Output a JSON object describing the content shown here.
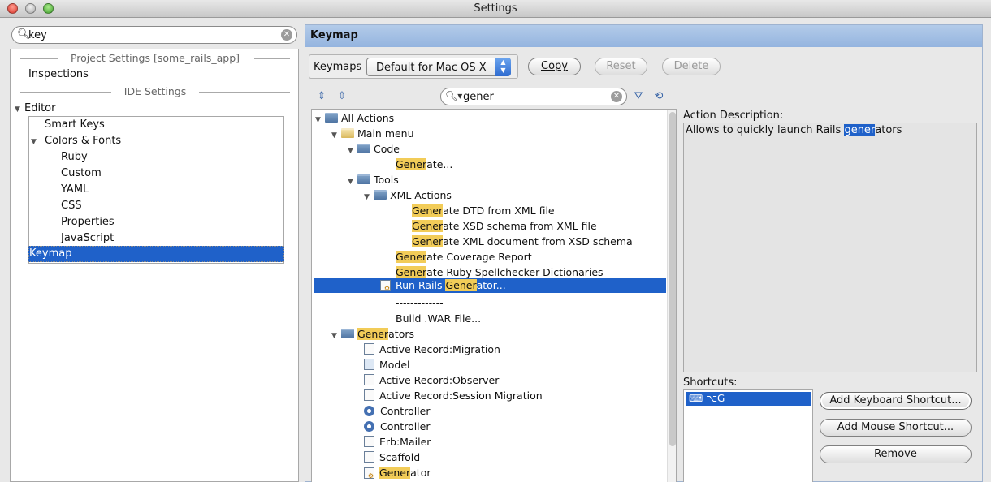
{
  "window": {
    "title": "Settings"
  },
  "left": {
    "search_value": "key",
    "sections": [
      "Project Settings [some_rails_app]",
      "IDE Settings"
    ],
    "inspections": "Inspections",
    "editor": "Editor",
    "smart_keys": "Smart Keys",
    "colors_fonts": "Colors & Fonts",
    "color_items": [
      "Ruby",
      "Custom",
      "YAML",
      "CSS",
      "Properties",
      "JavaScript"
    ],
    "keymap": "Keymap"
  },
  "header": {
    "title": "Keymap"
  },
  "keymaps": {
    "label": "Keymaps",
    "selected": "Default for Mac OS X"
  },
  "buttons": {
    "copy": "Copy",
    "reset": "Reset",
    "delete": "Delete"
  },
  "filter": {
    "value": "gener"
  },
  "tree": [
    {
      "pre": "",
      "hl": "",
      "post": "All Actions"
    },
    {
      "pre": "",
      "hl": "",
      "post": "Main menu"
    },
    {
      "pre": "",
      "hl": "",
      "post": "Code"
    },
    {
      "pre": "",
      "hl": "Gener",
      "post": "ate..."
    },
    {
      "pre": "",
      "hl": "",
      "post": "Tools"
    },
    {
      "pre": "",
      "hl": "",
      "post": "XML Actions"
    },
    {
      "pre": "",
      "hl": "Gener",
      "post": "ate DTD from XML file"
    },
    {
      "pre": "",
      "hl": "Gener",
      "post": "ate XSD schema from XML file"
    },
    {
      "pre": "",
      "hl": "Gener",
      "post": "ate XML document from XSD schema"
    },
    {
      "pre": "",
      "hl": "Gener",
      "post": "ate Coverage Report"
    },
    {
      "pre": "",
      "hl": "Gener",
      "post": "ate Ruby Spellchecker Dictionaries"
    },
    {
      "pre": "Run Rails ",
      "hl": "Gener",
      "post": "ator..."
    },
    {
      "pre": "",
      "hl": "",
      "post": "-------------"
    },
    {
      "pre": "",
      "hl": "",
      "post": "Build .WAR File..."
    },
    {
      "pre": "",
      "hl": "Gener",
      "post": "ators"
    },
    {
      "pre": "",
      "hl": "",
      "post": "Active Record:Migration"
    },
    {
      "pre": "",
      "hl": "",
      "post": "Model"
    },
    {
      "pre": "",
      "hl": "",
      "post": "Active Record:Observer"
    },
    {
      "pre": "",
      "hl": "",
      "post": "Active Record:Session Migration"
    },
    {
      "pre": "",
      "hl": "",
      "post": "Controller"
    },
    {
      "pre": "",
      "hl": "",
      "post": "Controller"
    },
    {
      "pre": "",
      "hl": "",
      "post": "Erb:Mailer"
    },
    {
      "pre": "",
      "hl": "",
      "post": "Scaffold"
    },
    {
      "pre": "",
      "hl": "Gener",
      "post": "ator"
    }
  ],
  "description": {
    "label": "Action Description:",
    "pre": "Allows to quickly launch Rails ",
    "sel": "gener",
    "post": "ators"
  },
  "shortcuts": {
    "label": "Shortcuts:",
    "items": [
      "⌥G"
    ],
    "add_keyboard": "Add Keyboard Shortcut...",
    "add_mouse": "Add Mouse Shortcut...",
    "remove": "Remove"
  }
}
